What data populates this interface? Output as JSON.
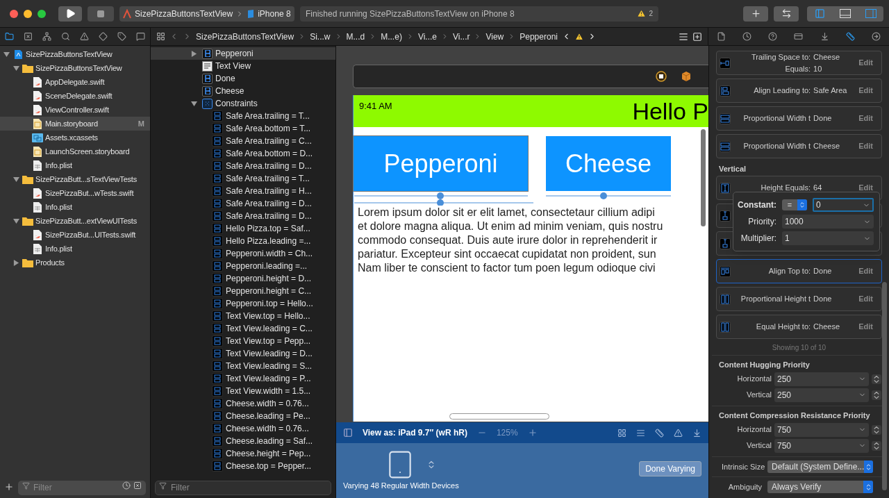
{
  "toolbar": {
    "scheme": "SizePizzaButtonsTextView",
    "device": "iPhone 8",
    "status": "Finished running SizePizzaButtonsTextView on iPhone 8",
    "warnings": "2"
  },
  "jump_bar": [
    "SizePizzaButtonsTextView",
    "Si...w",
    "M...d",
    "M...e)",
    "Vi...e",
    "Vi...r",
    "View",
    "Pepperoni"
  ],
  "navigator": {
    "tree": [
      {
        "label": "SizePizzaButtonsTextView",
        "kind": "project",
        "expanded": true,
        "selected": false,
        "children": [
          {
            "label": "SizePizzaButtonsTextView",
            "kind": "folder",
            "expanded": true,
            "selected": false,
            "children": [
              {
                "label": "AppDelegate.swift",
                "kind": "swift",
                "selected": false
              },
              {
                "label": "SceneDelegate.swift",
                "kind": "swift",
                "selected": false
              },
              {
                "label": "ViewController.swift",
                "kind": "swift",
                "selected": false
              },
              {
                "label": "Main.storyboard",
                "kind": "storyboard",
                "selected": true,
                "badge": "M"
              },
              {
                "label": "Assets.xcassets",
                "kind": "assets",
                "selected": false
              },
              {
                "label": "LaunchScreen.storyboard",
                "kind": "storyboard",
                "selected": false
              },
              {
                "label": "Info.plist",
                "kind": "plist",
                "selected": false
              }
            ]
          },
          {
            "label": "SizePizzaButt...sTextViewTests",
            "kind": "folder",
            "expanded": true,
            "selected": false,
            "children": [
              {
                "label": "SizePizzaBut...wTests.swift",
                "kind": "swift",
                "selected": false
              },
              {
                "label": "Info.plist",
                "kind": "plist",
                "selected": false
              }
            ]
          },
          {
            "label": "SizePizzaButt...extViewUITests",
            "kind": "folder",
            "expanded": true,
            "selected": false,
            "children": [
              {
                "label": "SizePizzaBut...UITests.swift",
                "kind": "swift",
                "selected": false
              },
              {
                "label": "Info.plist",
                "kind": "plist",
                "selected": false
              }
            ]
          },
          {
            "label": "Products",
            "kind": "folder",
            "expanded": false,
            "selected": false
          }
        ]
      }
    ],
    "filter": {
      "placeholder": "Filter"
    }
  },
  "outline": {
    "items": [
      {
        "label": "Pepperoni",
        "kind": "button",
        "expanded": false,
        "selected": true
      },
      {
        "label": "Text View",
        "kind": "textview",
        "selected": false
      },
      {
        "label": "Done",
        "kind": "button",
        "selected": false
      },
      {
        "label": "Cheese",
        "kind": "button",
        "selected": false
      },
      {
        "label": "Constraints",
        "kind": "constraints",
        "expanded": true,
        "selected": false,
        "children": [
          {
            "label": "Safe Area.trailing = T...",
            "kind": "constraint",
            "selected": false
          },
          {
            "label": "Safe Area.bottom = T...",
            "kind": "constraint",
            "selected": false
          },
          {
            "label": "Safe Area.trailing = C...",
            "kind": "constraint",
            "selected": false
          },
          {
            "label": "Safe Area.bottom = D...",
            "kind": "constraint",
            "selected": false
          },
          {
            "label": "Safe Area.trailing = D...",
            "kind": "constraint",
            "selected": false
          },
          {
            "label": "Safe Area.trailing = T...",
            "kind": "constraint",
            "selected": false
          },
          {
            "label": "Safe Area.trailing = H...",
            "kind": "constraint",
            "selected": false
          },
          {
            "label": "Safe Area.trailing = D...",
            "kind": "constraint",
            "selected": false
          },
          {
            "label": "Safe Area.trailing = D...",
            "kind": "constraint",
            "selected": false
          },
          {
            "label": "Hello Pizza.top = Saf...",
            "kind": "constraint",
            "selected": false
          },
          {
            "label": "Hello Pizza.leading =...",
            "kind": "constraint",
            "selected": false
          },
          {
            "label": "Pepperoni.width = Ch...",
            "kind": "constraint",
            "selected": false
          },
          {
            "label": "Pepperoni.leading =...",
            "kind": "constraint",
            "selected": false
          },
          {
            "label": "Pepperoni.height = D...",
            "kind": "constraint",
            "selected": false
          },
          {
            "label": "Pepperoni.height = C...",
            "kind": "constraint",
            "selected": false
          },
          {
            "label": "Pepperoni.top = Hello...",
            "kind": "constraint",
            "selected": false
          },
          {
            "label": "Text View.top = Hello...",
            "kind": "constraint",
            "selected": false
          },
          {
            "label": "Text View.leading = C...",
            "kind": "constraint",
            "selected": false
          },
          {
            "label": "Text View.top = Pepp...",
            "kind": "constraint",
            "selected": false
          },
          {
            "label": "Text View.leading = D...",
            "kind": "constraint",
            "selected": false
          },
          {
            "label": "Text View.leading = S...",
            "kind": "constraint",
            "selected": false
          },
          {
            "label": "Text View.leading = P...",
            "kind": "constraint",
            "selected": false
          },
          {
            "label": "Text View.width = 1.5...",
            "kind": "constraint",
            "selected": false
          },
          {
            "label": "Cheese.width = 0.76...",
            "kind": "constraint",
            "selected": false
          },
          {
            "label": "Cheese.leading = Pe...",
            "kind": "constraint",
            "selected": false
          },
          {
            "label": "Cheese.width = 0.76...",
            "kind": "constraint",
            "selected": false
          },
          {
            "label": "Cheese.leading = Saf...",
            "kind": "constraint",
            "selected": false
          },
          {
            "label": "Cheese.height = Pep...",
            "kind": "constraint",
            "selected": false
          },
          {
            "label": "Cheese.top = Pepper...",
            "kind": "constraint",
            "selected": false
          }
        ]
      }
    ],
    "filter": {
      "placeholder": "Filter"
    }
  },
  "canvas": {
    "time": "9:41 AM",
    "heading": "Hello P",
    "buttons": [
      "Pepperoni",
      "Cheese"
    ],
    "text_lines": [
      "Lorem ipsum dolor sit er elit lamet, consectetaur cillium adipi",
      "et dolore magna aliqua. Ut enim ad minim veniam, quis nostru",
      "commodo consequat. Duis aute irure dolor in reprehenderit ir",
      "pariatur. Excepteur sint occaecat cupidatat non proident, sun",
      "Nam liber te conscient to factor tum poen legum odioque civi"
    ],
    "view_as": "View as: iPad 9.7″ (wR hR)",
    "zoom": "125%",
    "varying": "Varying 48 Regular Width Devices",
    "done_button": "Done Varying"
  },
  "inspector": {
    "cards": [
      {
        "kind": "trailing",
        "label": "Trailing Space to:",
        "value": "Cheese",
        "extra_label": "Equals:",
        "extra_value": "10",
        "edit": "Edit",
        "selected": false
      },
      {
        "kind": "leading",
        "label": "Align Leading to:",
        "value": "Safe Area",
        "edit": "Edit",
        "selected": false
      },
      {
        "kind": "width",
        "label": "Proportional Width t",
        "value": "Done",
        "edit": "Edit",
        "selected": false
      },
      {
        "kind": "width",
        "label": "Proportional Width t",
        "value": "Cheese",
        "edit": "Edit",
        "selected": false
      }
    ],
    "vertical_title": "Vertical",
    "vertical_cards": [
      {
        "kind": "height",
        "label": "Height Equals:",
        "value": "64",
        "edit": "Edit",
        "selected": false
      },
      {
        "kind": "top",
        "selected": false
      },
      {
        "kind": "top",
        "selected": false
      },
      {
        "kind": "aligntop",
        "label": "Align Top to:",
        "value": "Done",
        "edit": "Edit",
        "selected": true
      },
      {
        "kind": "propheight",
        "label": "Proportional Height t",
        "value": "Done",
        "edit": "Edit",
        "selected": false
      },
      {
        "kind": "propheight",
        "label": "Equal Height to:",
        "value": "Cheese",
        "edit": "Edit",
        "selected": false
      }
    ],
    "popover": {
      "constant_label": "Constant:",
      "relation": "=",
      "constant": "0",
      "priority_label": "Priority:",
      "priority": "1000",
      "multiplier_label": "Multiplier:",
      "multiplier": "1"
    },
    "showing": "Showing 10 of 10",
    "hugging": {
      "title": "Content Hugging Priority",
      "rows": [
        {
          "label": "Horizontal",
          "value": "250"
        },
        {
          "label": "Vertical",
          "value": "250"
        }
      ]
    },
    "compression": {
      "title": "Content Compression Resistance Priority",
      "rows": [
        {
          "label": "Horizontal",
          "value": "750"
        },
        {
          "label": "Vertical",
          "value": "750"
        }
      ]
    },
    "intrinsic": {
      "label": "Intrinsic Size",
      "value": "Default (System Define..."
    },
    "ambiguity": {
      "label": "Ambiguity",
      "value": "Always Verify"
    }
  }
}
